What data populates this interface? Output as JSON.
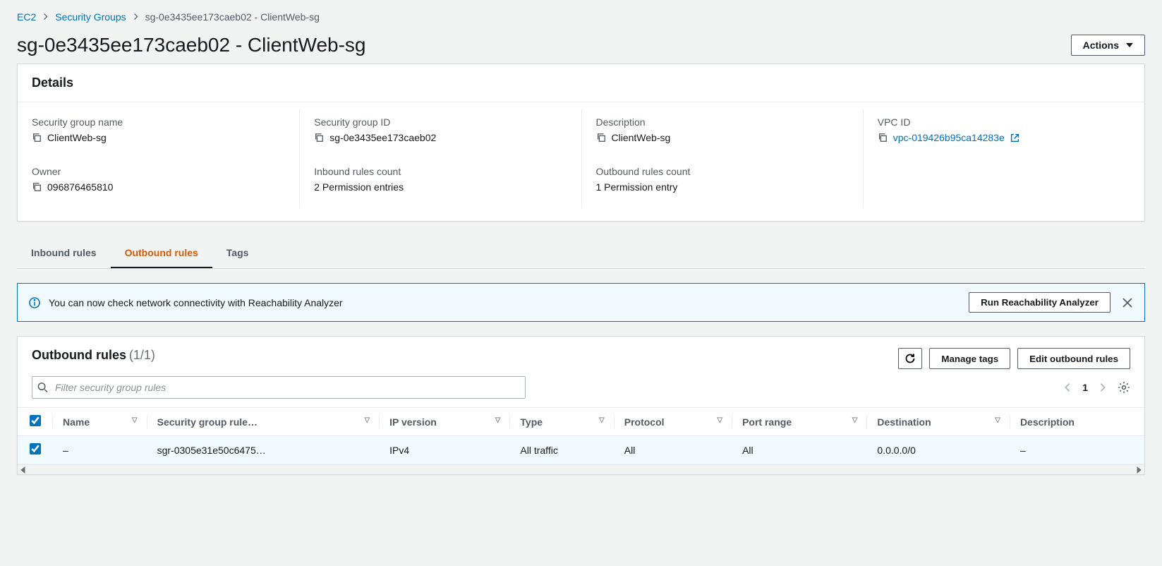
{
  "breadcrumb": {
    "root": "EC2",
    "level1": "Security Groups",
    "current": "sg-0e3435ee173caeb02 - ClientWeb-sg"
  },
  "header": {
    "title": "sg-0e3435ee173caeb02 - ClientWeb-sg",
    "actions_label": "Actions"
  },
  "details": {
    "heading": "Details",
    "fields": {
      "sg_name": {
        "label": "Security group name",
        "value": "ClientWeb-sg"
      },
      "sg_id": {
        "label": "Security group ID",
        "value": "sg-0e3435ee173caeb02"
      },
      "description": {
        "label": "Description",
        "value": "ClientWeb-sg"
      },
      "vpc_id": {
        "label": "VPC ID",
        "value": "vpc-019426b95ca14283e"
      },
      "owner": {
        "label": "Owner",
        "value": "096876465810"
      },
      "inbound_count": {
        "label": "Inbound rules count",
        "value": "2 Permission entries"
      },
      "outbound_count": {
        "label": "Outbound rules count",
        "value": "1 Permission entry"
      }
    }
  },
  "tabs": {
    "inbound": "Inbound rules",
    "outbound": "Outbound rules",
    "tags": "Tags"
  },
  "banner": {
    "text": "You can now check network connectivity with Reachability Analyzer",
    "button": "Run Reachability Analyzer"
  },
  "rules": {
    "title": "Outbound rules",
    "count": "(1/1)",
    "manage_tags": "Manage tags",
    "edit_rules": "Edit outbound rules",
    "filter_placeholder": "Filter security group rules",
    "page": "1",
    "columns": {
      "name": "Name",
      "rule_id": "Security group rule…",
      "ip_version": "IP version",
      "type": "Type",
      "protocol": "Protocol",
      "port_range": "Port range",
      "destination": "Destination",
      "description": "Description"
    },
    "row": {
      "name": "–",
      "rule_id": "sgr-0305e31e50c6475…",
      "ip_version": "IPv4",
      "type": "All traffic",
      "protocol": "All",
      "port_range": "All",
      "destination": "0.0.0.0/0",
      "description": "–"
    }
  }
}
